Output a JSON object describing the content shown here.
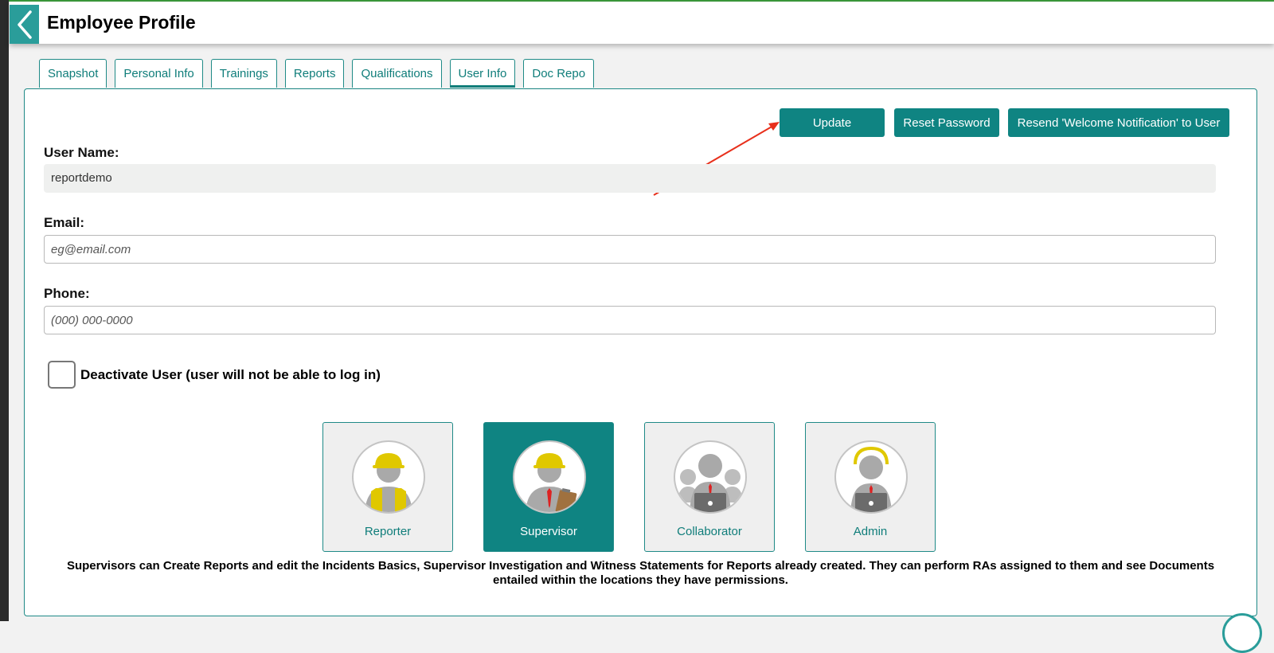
{
  "header": {
    "title": "Employee Profile",
    "back_icon": "chevron-left-icon"
  },
  "tabs": [
    {
      "label": "Snapshot",
      "active": false
    },
    {
      "label": "Personal Info",
      "active": false
    },
    {
      "label": "Trainings",
      "active": false
    },
    {
      "label": "Reports",
      "active": false
    },
    {
      "label": "Qualifications",
      "active": false
    },
    {
      "label": "User Info",
      "active": true
    },
    {
      "label": "Doc Repo",
      "active": false
    }
  ],
  "actions": {
    "update_label": "Update",
    "reset_password_label": "Reset Password",
    "resend_label": "Resend 'Welcome Notification' to User"
  },
  "form": {
    "username_label": "User Name:",
    "username_value": "reportdemo",
    "email_label": "Email:",
    "email_placeholder": "eg@email.com",
    "phone_label": "Phone:",
    "phone_placeholder": "(000) 000-0000",
    "deactivate_label": "Deactivate User (user will not be able to log in)",
    "deactivate_checked": false
  },
  "roles": {
    "items": [
      {
        "label": "Reporter",
        "icon": "reporter-icon",
        "selected": false
      },
      {
        "label": "Supervisor",
        "icon": "supervisor-icon",
        "selected": true
      },
      {
        "label": "Collaborator",
        "icon": "collaborator-icon",
        "selected": false
      },
      {
        "label": "Admin",
        "icon": "admin-icon",
        "selected": false
      }
    ],
    "description": "Supervisors can Create Reports and edit the Incidents Basics, Supervisor Investigation and Witness Statements for Reports already created. They can perform RAs assigned to them and see Documents entailed within the locations they have permissions."
  },
  "annotation": {
    "type": "arrow",
    "color": "#e8301c",
    "points_to": "Update"
  },
  "colors": {
    "accent": "#0f8482",
    "header_back": "#2a9d9a",
    "hardhat": "#e0c800"
  }
}
